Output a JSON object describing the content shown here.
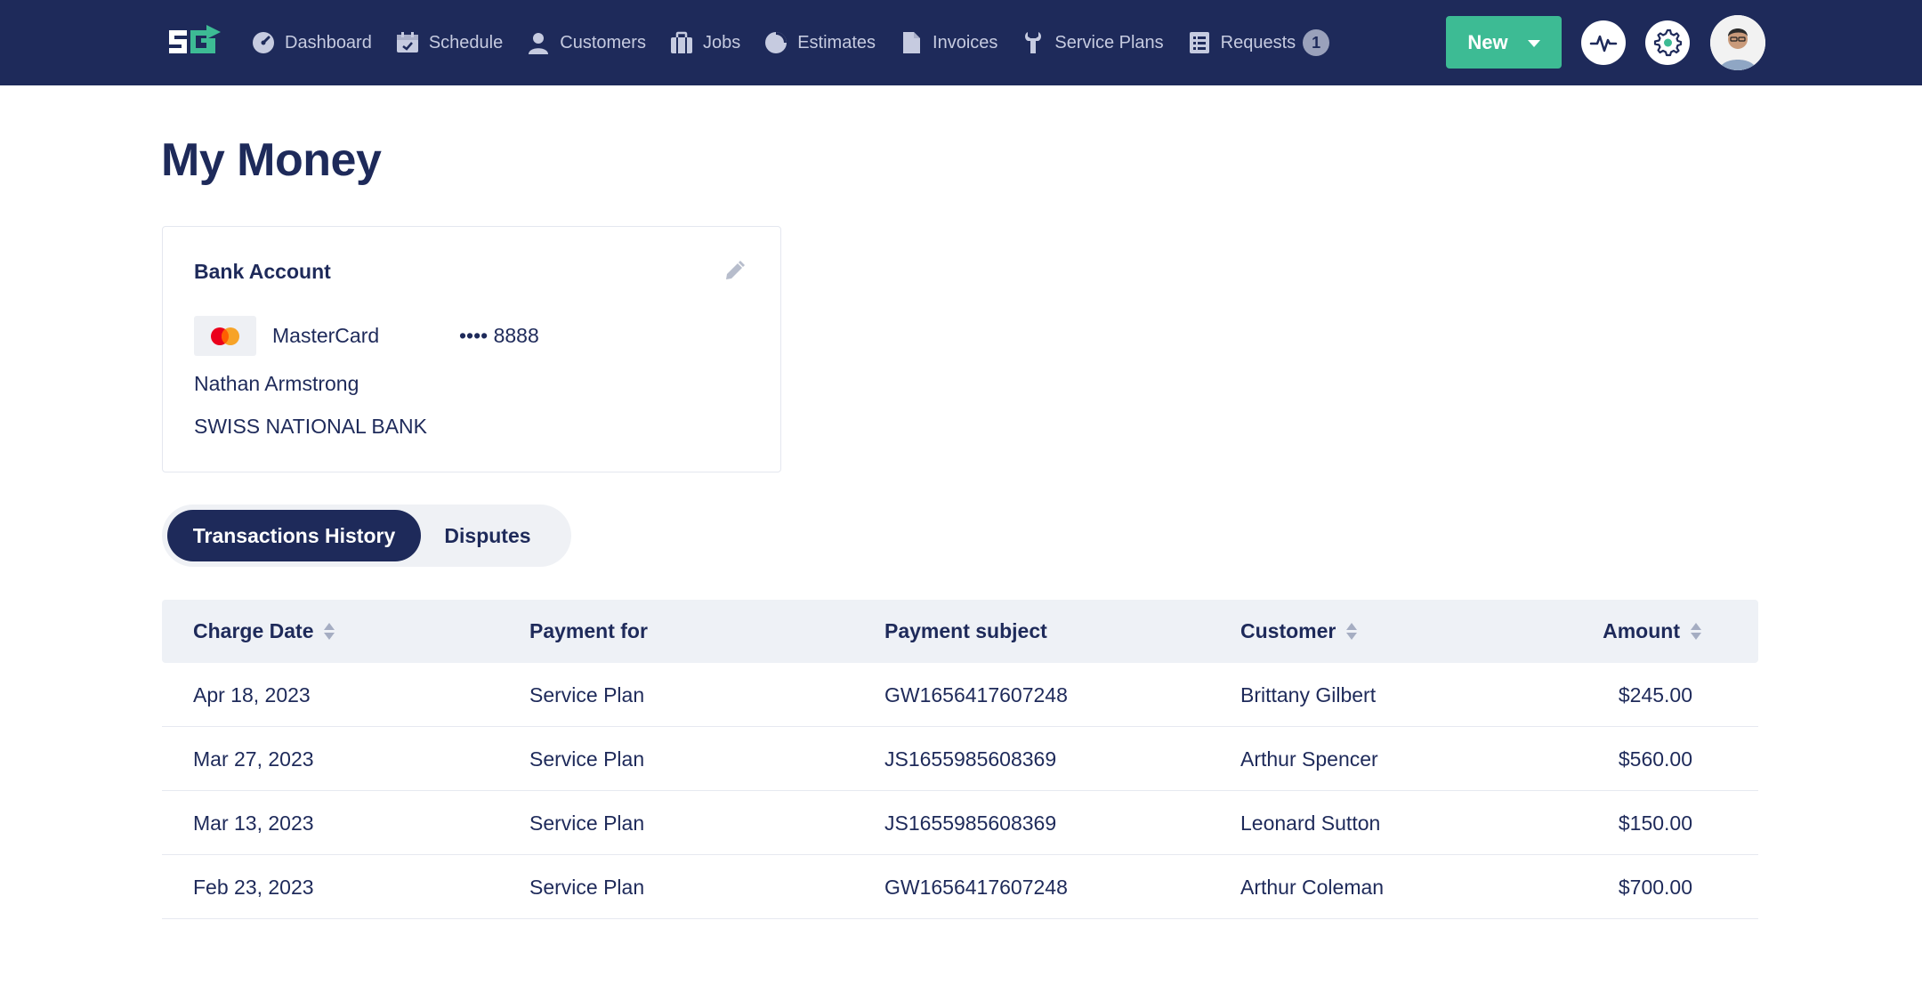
{
  "nav": {
    "items": [
      {
        "label": "Dashboard",
        "icon": "dashboard-icon"
      },
      {
        "label": "Schedule",
        "icon": "calendar-icon"
      },
      {
        "label": "Customers",
        "icon": "user-icon"
      },
      {
        "label": "Jobs",
        "icon": "briefcase-icon"
      },
      {
        "label": "Estimates",
        "icon": "pie-icon"
      },
      {
        "label": "Invoices",
        "icon": "document-icon"
      },
      {
        "label": "Service Plans",
        "icon": "wrench-icon"
      },
      {
        "label": "Requests",
        "icon": "list-icon"
      }
    ],
    "requests_badge": "1",
    "new_label": "New"
  },
  "page": {
    "title": "My Money"
  },
  "bank_card": {
    "title": "Bank Account",
    "card_brand": "MasterCard",
    "masked_number": "•••• 8888",
    "holder": "Nathan Armstrong",
    "bank": "SWISS NATIONAL BANK"
  },
  "tabs": {
    "active": "Transactions History",
    "inactive": "Disputes"
  },
  "table": {
    "headers": {
      "charge_date": "Charge Date",
      "payment_for": "Payment for",
      "payment_subject": "Payment subject",
      "customer": "Customer",
      "amount": "Amount"
    },
    "rows": [
      {
        "date": "Apr 18, 2023",
        "for": "Service Plan",
        "subject": "GW1656417607248",
        "customer": "Brittany Gilbert",
        "amount": "$245.00"
      },
      {
        "date": "Mar 27, 2023",
        "for": "Service Plan",
        "subject": "JS1655985608369",
        "customer": "Arthur Spencer",
        "amount": "$560.00"
      },
      {
        "date": "Mar 13, 2023",
        "for": "Service Plan",
        "subject": "JS1655985608369",
        "customer": "Leonard Sutton",
        "amount": "$150.00"
      },
      {
        "date": "Feb 23, 2023",
        "for": "Service Plan",
        "subject": "GW1656417607248",
        "customer": "Arthur Coleman",
        "amount": "$700.00"
      }
    ]
  },
  "colors": {
    "navy": "#1e2a5a",
    "accent_green": "#3dbb94",
    "header_bg": "#eef1f6"
  }
}
